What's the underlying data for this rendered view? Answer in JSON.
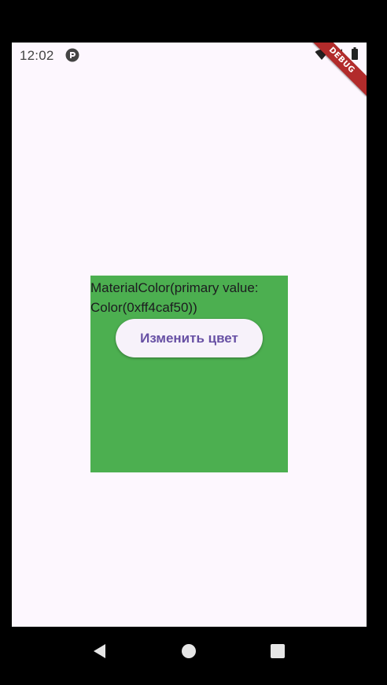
{
  "status_bar": {
    "time": "12:02",
    "icons": [
      "pocket-casts-icon",
      "wifi-icon",
      "signal-icon",
      "battery-icon"
    ]
  },
  "debug_banner": {
    "label": "DEBUG"
  },
  "main": {
    "box_color": "#4caf50",
    "color_text": "MaterialColor(primary value: Color(0xff4caf50))",
    "button_label": "Изменить цвет"
  },
  "nav_bar": {
    "icons": [
      "back-icon",
      "home-icon",
      "recents-icon"
    ]
  },
  "colors": {
    "background": "#fdf7fe",
    "accent": "#6750a4",
    "box": "#4caf50",
    "debug_banner": "#b22b2b"
  }
}
